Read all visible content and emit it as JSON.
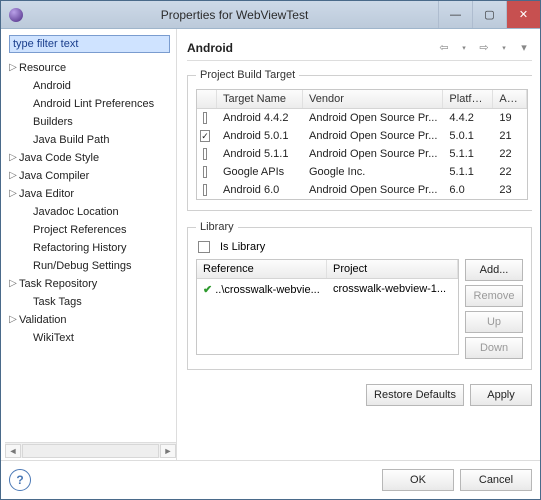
{
  "window": {
    "title": "Properties for WebViewTest"
  },
  "filter": {
    "placeholder": "type filter text"
  },
  "tree": {
    "items": [
      {
        "label": "Resource",
        "expandable": true
      },
      {
        "label": "Android",
        "selected": true
      },
      {
        "label": "Android Lint Preferences"
      },
      {
        "label": "Builders"
      },
      {
        "label": "Java Build Path"
      },
      {
        "label": "Java Code Style",
        "expandable": true
      },
      {
        "label": "Java Compiler",
        "expandable": true
      },
      {
        "label": "Java Editor",
        "expandable": true
      },
      {
        "label": "Javadoc Location"
      },
      {
        "label": "Project References"
      },
      {
        "label": "Refactoring History"
      },
      {
        "label": "Run/Debug Settings"
      },
      {
        "label": "Task Repository",
        "expandable": true
      },
      {
        "label": "Task Tags"
      },
      {
        "label": "Validation",
        "expandable": true
      },
      {
        "label": "WikiText"
      }
    ]
  },
  "main": {
    "heading": "Android",
    "build_target": {
      "legend": "Project Build Target",
      "columns": {
        "name": "Target Name",
        "vendor": "Vendor",
        "platform": "Platfo...",
        "api": "AP..."
      },
      "rows": [
        {
          "checked": false,
          "name": "Android 4.4.2",
          "vendor": "Android Open Source Pr...",
          "platform": "4.4.2",
          "api": "19"
        },
        {
          "checked": true,
          "name": "Android 5.0.1",
          "vendor": "Android Open Source Pr...",
          "platform": "5.0.1",
          "api": "21"
        },
        {
          "checked": false,
          "name": "Android 5.1.1",
          "vendor": "Android Open Source Pr...",
          "platform": "5.1.1",
          "api": "22"
        },
        {
          "checked": false,
          "name": "Google APIs",
          "vendor": "Google Inc.",
          "platform": "5.1.1",
          "api": "22"
        },
        {
          "checked": false,
          "name": "Android 6.0",
          "vendor": "Android Open Source Pr...",
          "platform": "6.0",
          "api": "23"
        }
      ]
    },
    "library": {
      "legend": "Library",
      "is_library_label": "Is Library",
      "columns": {
        "ref": "Reference",
        "proj": "Project"
      },
      "rows": [
        {
          "status": "ok",
          "ref": "..\\crosswalk-webvie...",
          "proj": "crosswalk-webview-1..."
        }
      ],
      "buttons": {
        "add": "Add...",
        "remove": "Remove",
        "up": "Up",
        "down": "Down"
      }
    },
    "footer_buttons": {
      "restore": "Restore Defaults",
      "apply": "Apply"
    }
  },
  "dialog_buttons": {
    "ok": "OK",
    "cancel": "Cancel"
  }
}
